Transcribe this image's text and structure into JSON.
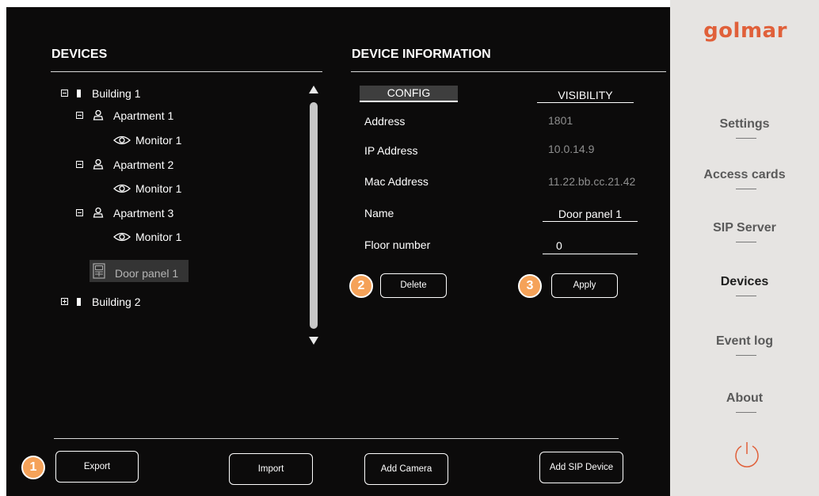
{
  "brand": {
    "logo_text": "golmar",
    "color": "#e0603a"
  },
  "devices_panel": {
    "title": "DEVICES",
    "tree": [
      {
        "label": "Building 1"
      },
      {
        "label": "Apartment 1"
      },
      {
        "label": "Monitor 1"
      },
      {
        "label": "Apartment 2"
      },
      {
        "label": "Monitor 1"
      },
      {
        "label": "Apartment 3"
      },
      {
        "label": "Monitor 1"
      },
      {
        "label": "Door panel 1",
        "selected": true
      },
      {
        "label": "Building 2"
      }
    ]
  },
  "info_panel": {
    "title": "DEVICE INFORMATION",
    "tabs": [
      {
        "label": "CONFIG",
        "active": true
      },
      {
        "label": "VISIBILITY",
        "active": false
      }
    ],
    "fields": {
      "address": {
        "label": "Address",
        "value": "1801"
      },
      "ip": {
        "label": "IP Address",
        "value": "10.0.14.9"
      },
      "mac": {
        "label": "Mac Address",
        "value": "11.22.bb.cc.21.42"
      },
      "name": {
        "label": "Name",
        "value": "Door panel 1"
      },
      "floor": {
        "label": "Floor number",
        "value": "0"
      }
    },
    "delete_label": "Delete",
    "apply_label": "Apply"
  },
  "bottom_buttons": {
    "export": "Export",
    "import": "Import",
    "add_camera": "Add Camera",
    "add_sip": "Add SIP Device"
  },
  "badges": {
    "b1": "1",
    "b2": "2",
    "b3": "3",
    "color": "#f5a259"
  },
  "sidebar": {
    "items": [
      {
        "label": "Settings"
      },
      {
        "label": "Access cards"
      },
      {
        "label": "SIP Server"
      },
      {
        "label": "Devices",
        "active": true
      },
      {
        "label": "Event log"
      },
      {
        "label": "About"
      }
    ],
    "power_icon": "power-icon"
  }
}
